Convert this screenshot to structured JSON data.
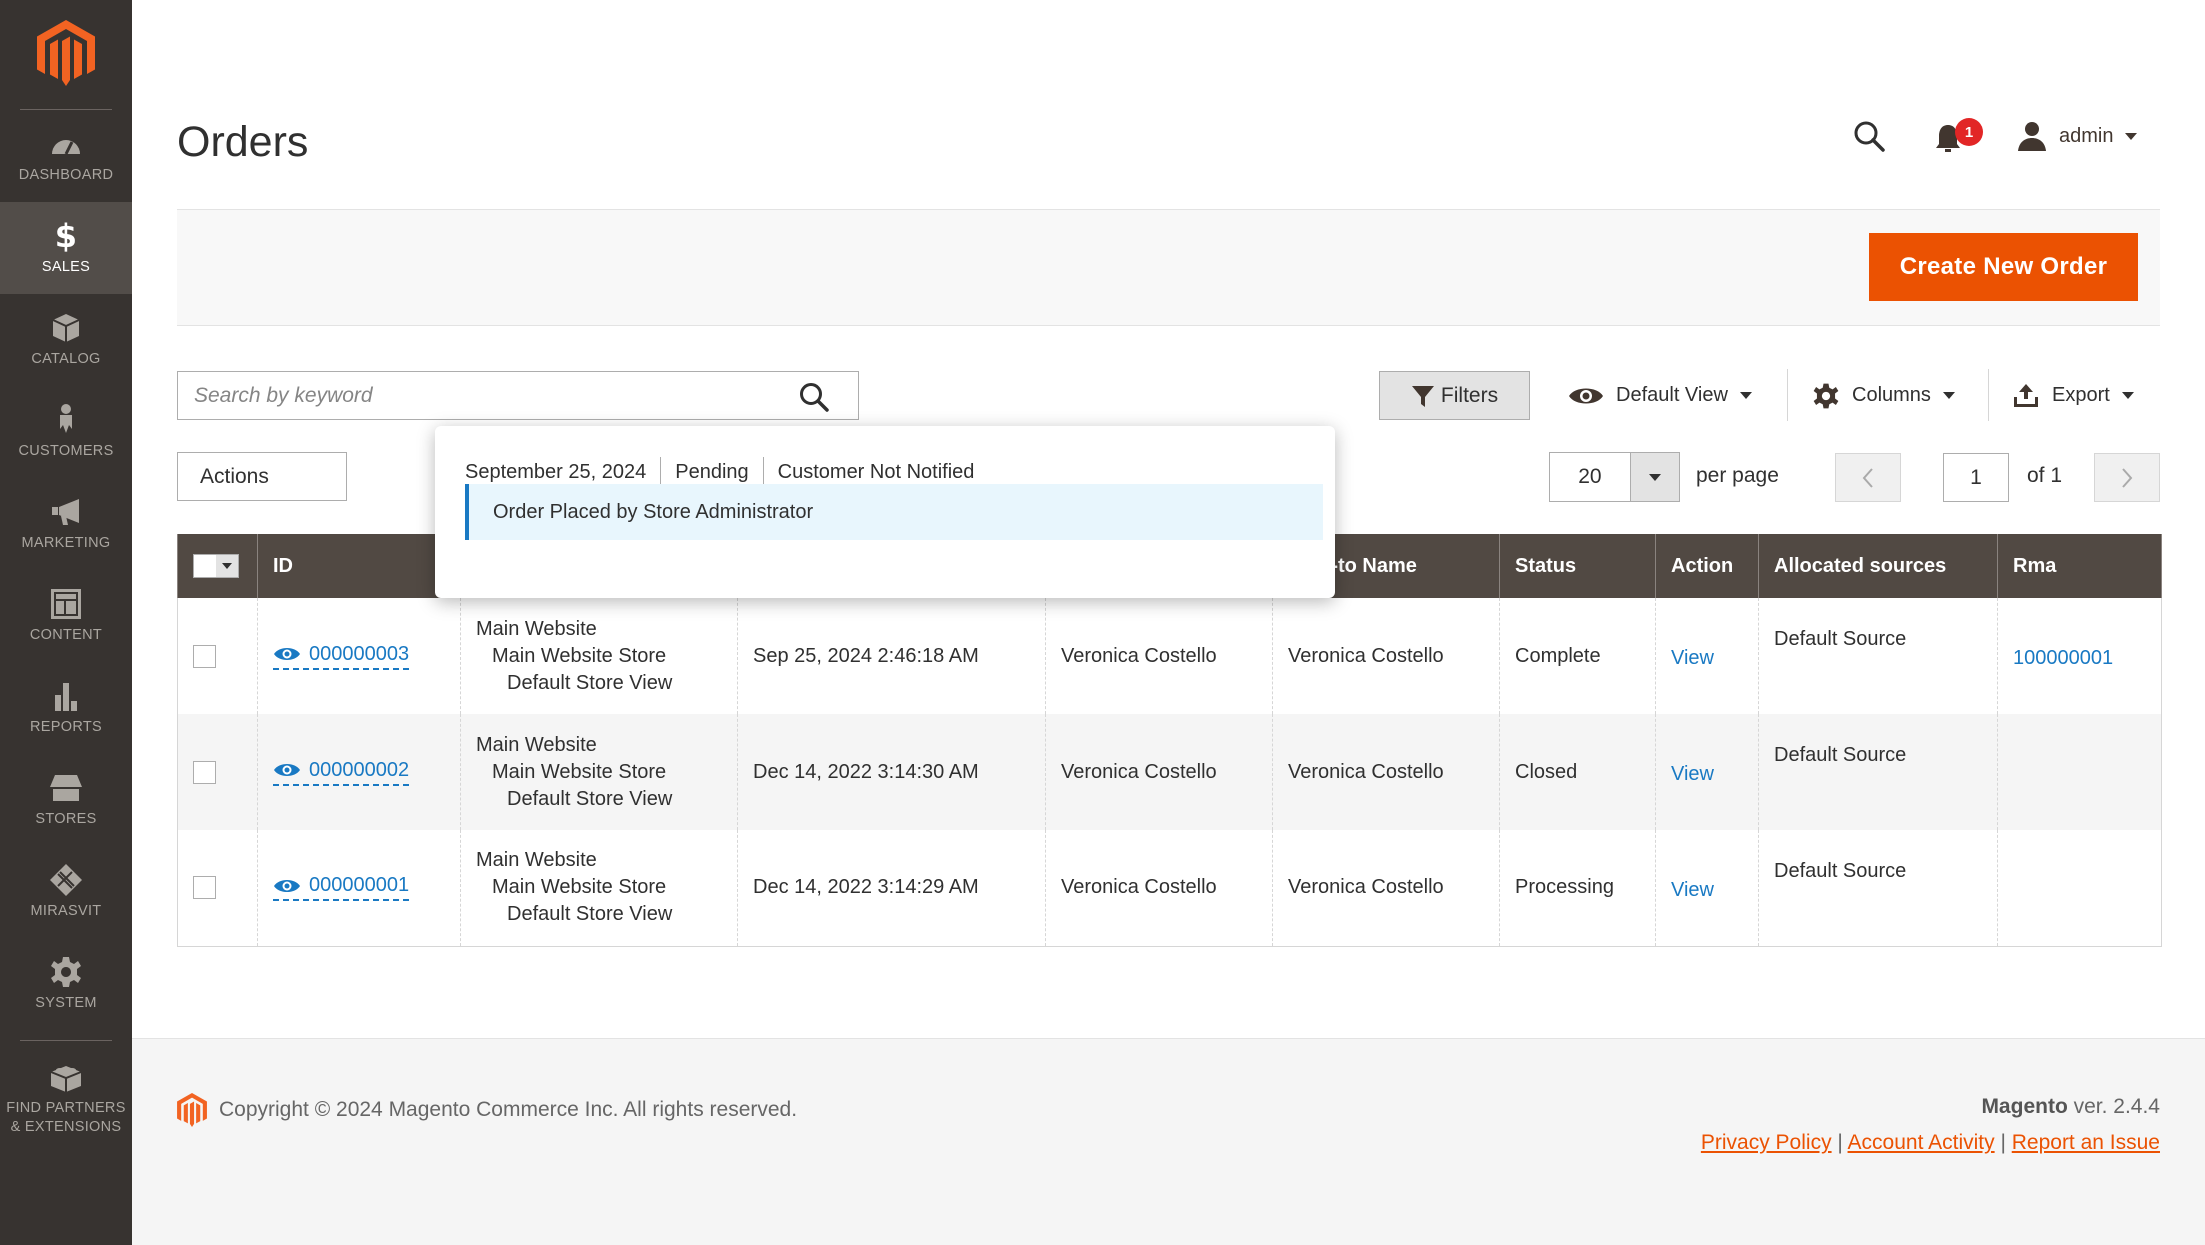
{
  "sidebar": {
    "items": [
      {
        "label": "DASHBOARD",
        "icon": "dashboard-icon"
      },
      {
        "label": "SALES",
        "icon": "dollar-icon",
        "active": true
      },
      {
        "label": "CATALOG",
        "icon": "box-icon"
      },
      {
        "label": "CUSTOMERS",
        "icon": "person-icon"
      },
      {
        "label": "MARKETING",
        "icon": "megaphone-icon"
      },
      {
        "label": "CONTENT",
        "icon": "layout-icon"
      },
      {
        "label": "REPORTS",
        "icon": "bar-chart-icon"
      },
      {
        "label": "STORES",
        "icon": "storefront-icon"
      },
      {
        "label": "MIRASVIT",
        "icon": "mirasvit-icon"
      },
      {
        "label": "SYSTEM",
        "icon": "gear-icon"
      },
      {
        "label_line1": "FIND PARTNERS",
        "label_line2": "& EXTENSIONS",
        "icon": "lego-brick-icon"
      }
    ]
  },
  "header": {
    "title": "Orders",
    "notifications_count": "1",
    "user": "admin"
  },
  "action_bar": {
    "create_button": "Create New Order"
  },
  "toolbar": {
    "search_placeholder": "Search by keyword",
    "filters": "Filters",
    "view": "Default View",
    "columns": "Columns",
    "export": "Export",
    "actions": "Actions",
    "per_page_value": "20",
    "per_page_label": "per page",
    "page_value": "1",
    "page_of": "of 1"
  },
  "popup": {
    "date": "September 25, 2024",
    "status": "Pending",
    "notified": "Customer Not Notified",
    "comment": "Order Placed by Store Administrator"
  },
  "grid": {
    "columns": [
      "ID",
      "",
      "",
      "",
      "Ship-to Name",
      "Status",
      "Action",
      "Allocated sources",
      "Rma"
    ],
    "rows": [
      {
        "id": "000000003",
        "pp1": "Main Website",
        "pp2": "Main Website Store",
        "pp3": "Default Store View",
        "date": "Sep 25, 2024 2:46:18 AM",
        "bill_to": "Veronica Costello",
        "ship_to": "Veronica Costello",
        "status": "Complete",
        "action": "View",
        "source": "Default Source",
        "rma": "100000001"
      },
      {
        "id": "000000002",
        "pp1": "Main Website",
        "pp2": "Main Website Store",
        "pp3": "Default Store View",
        "date": "Dec 14, 2022 3:14:30 AM",
        "bill_to": "Veronica Costello",
        "ship_to": "Veronica Costello",
        "status": "Closed",
        "action": "View",
        "source": "Default Source",
        "rma": ""
      },
      {
        "id": "000000001",
        "pp1": "Main Website",
        "pp2": "Main Website Store",
        "pp3": "Default Store View",
        "date": "Dec 14, 2022 3:14:29 AM",
        "bill_to": "Veronica Costello",
        "ship_to": "Veronica Costello",
        "status": "Processing",
        "action": "View",
        "source": "Default Source",
        "rma": ""
      }
    ]
  },
  "footer": {
    "copyright": "Copyright © 2024 Magento Commerce Inc. All rights reserved.",
    "brand": "Magento",
    "version": " ver. 2.4.4",
    "links": [
      "Privacy Policy",
      "Account Activity",
      "Report an Issue"
    ]
  },
  "colors": {
    "accent": "#eb5202",
    "link": "#1979c3",
    "sidebar_bg": "#373330",
    "grid_header_bg": "#514943",
    "badge": "#e22626"
  }
}
